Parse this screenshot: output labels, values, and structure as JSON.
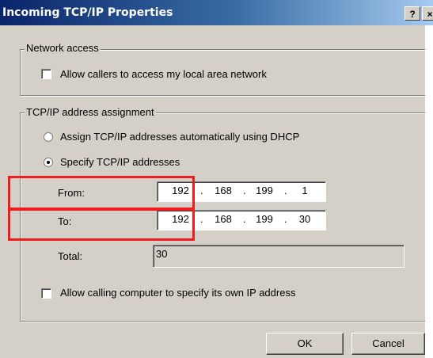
{
  "window": {
    "title": "Incoming TCP/IP Properties",
    "help_glyph": "?",
    "close_glyph": "×"
  },
  "network_access": {
    "legend": "Network access",
    "allow_lan_label": "Allow callers to access my local area network",
    "allow_lan_checked": false
  },
  "tcpip": {
    "legend": "TCP/IP address assignment",
    "dhcp_label": "Assign TCP/IP addresses automatically using DHCP",
    "specify_label": "Specify TCP/IP addresses",
    "selected": "specify",
    "from_label": "From:",
    "from_ip": [
      "192",
      "168",
      "199",
      "1"
    ],
    "to_label": "To:",
    "to_ip": [
      "192",
      "168",
      "199",
      "30"
    ],
    "ip_separator": ".",
    "total_label": "Total:",
    "total_value": "30",
    "allow_own_ip_label": "Allow calling computer to specify its own IP address",
    "allow_own_ip_checked": false
  },
  "buttons": {
    "ok": "OK",
    "cancel": "Cancel"
  },
  "annotation": {
    "highlight_color": "#ee1c1c"
  }
}
